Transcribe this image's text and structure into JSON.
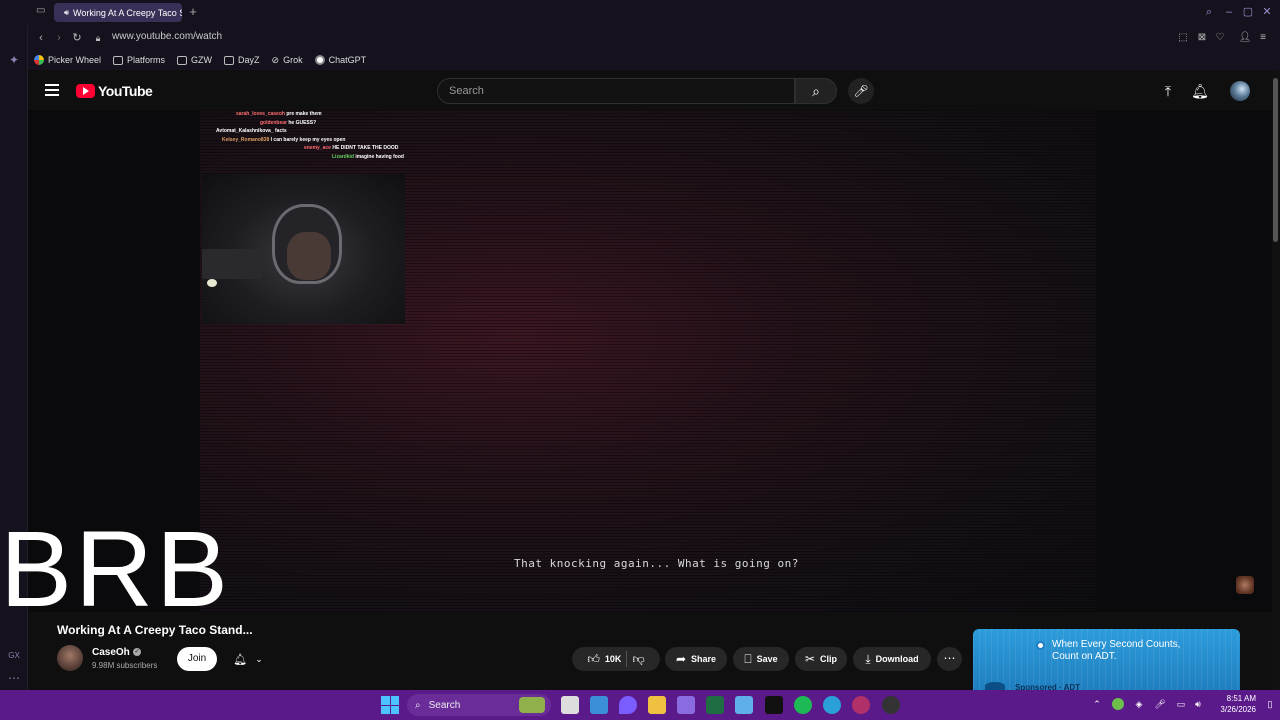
{
  "browser": {
    "tab_title": "Working At A Creepy Taco Stand",
    "url": "www.youtube.com/watch",
    "bookmarks": [
      {
        "label": "Picker Wheel",
        "icon": "picker-wheel-icon"
      },
      {
        "label": "Platforms",
        "icon": "folder-icon"
      },
      {
        "label": "GZW",
        "icon": "folder-icon"
      },
      {
        "label": "DayZ",
        "icon": "folder-icon"
      },
      {
        "label": "Grok",
        "icon": "grok-icon"
      },
      {
        "label": "ChatGPT",
        "icon": "chatgpt-icon"
      }
    ],
    "side_rail_label": "GX"
  },
  "youtube": {
    "logo_text": "YouTube",
    "search_placeholder": "Search"
  },
  "player": {
    "chat_lines": [
      {
        "name": "sarah_loves_caseoh",
        "msg": "pre make them"
      },
      {
        "name": "goldenbear",
        "msg": "he GUESS?"
      },
      {
        "name": "Avtomat_Kalashnikova_",
        "msg": "facts"
      },
      {
        "name": "Kelsey_Romano838",
        "msg": "I can barely keep my eyes open"
      },
      {
        "name": "enemy_ace",
        "msg": "HE DIDNT TAKE THE DOOD"
      },
      {
        "name": "Lizardkid",
        "msg": "imagine having food"
      }
    ],
    "overlay_text": "BRB",
    "subtitle": "That knocking again... What is going on?"
  },
  "video": {
    "title": "Working At A Creepy Taco Stand...",
    "channel": "CaseOh",
    "subscribers": "9.98M subscribers",
    "join_label": "Join",
    "like_count": "10K",
    "share_label": "Share",
    "save_label": "Save",
    "clip_label": "Clip",
    "download_label": "Download"
  },
  "ad": {
    "headline": "When Every Second Counts, Count on ADT.",
    "sub": "Sponsored · ADT"
  },
  "taskbar": {
    "search_label": "Search",
    "time": "8:51 AM",
    "date": "3/26/2026"
  },
  "colors": {
    "accent_purple": "#5a1a8a",
    "youtube_red": "#ff0033",
    "ad_blue": "#2d9cdb"
  }
}
